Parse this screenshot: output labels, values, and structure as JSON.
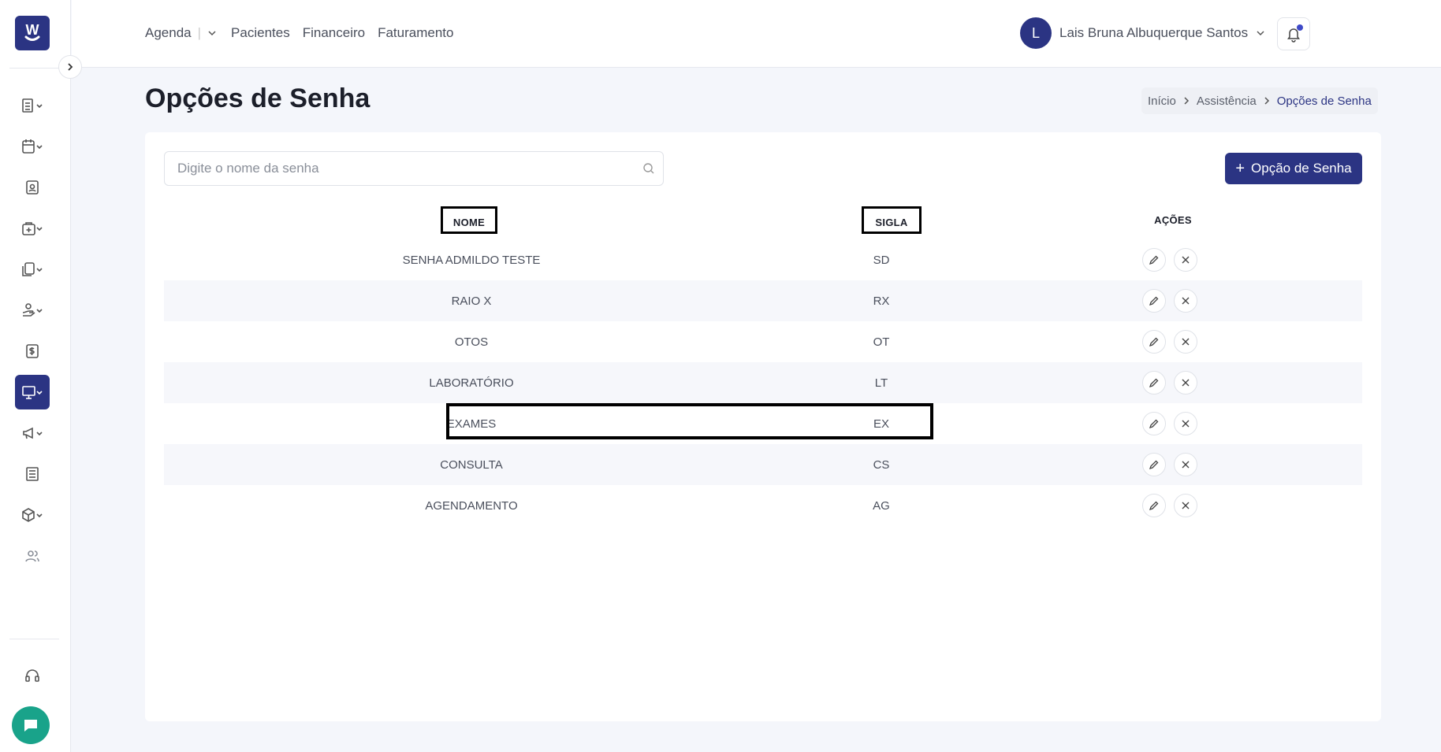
{
  "sidebar": {
    "logo_letter": "W",
    "items": [
      {
        "icon": "list-icon"
      },
      {
        "icon": "calendar-icon"
      },
      {
        "icon": "patient-card-icon"
      },
      {
        "icon": "medical-bag-icon"
      },
      {
        "icon": "documents-icon"
      },
      {
        "icon": "hand-care-icon"
      },
      {
        "icon": "dollar-icon"
      },
      {
        "icon": "monitor-icon"
      },
      {
        "icon": "megaphone-icon"
      },
      {
        "icon": "newspaper-icon"
      },
      {
        "icon": "box-icon"
      },
      {
        "icon": "users-icon"
      }
    ],
    "support_icon": "headset-icon",
    "chat_icon": "chat-icon"
  },
  "topbar": {
    "nav": [
      "Agenda",
      "Pacientes",
      "Financeiro",
      "Faturamento"
    ],
    "user_initial": "L",
    "user_name": "Lais Bruna Albuquerque Santos"
  },
  "page": {
    "title": "Opções de Senha",
    "breadcrumb": [
      "Início",
      "Assistência",
      "Opções de Senha"
    ]
  },
  "search": {
    "placeholder": "Digite o nome da senha",
    "value": ""
  },
  "add_button_label": "Opção de Senha",
  "table": {
    "headers": {
      "nome": "NOME",
      "sigla": "SIGLA",
      "acoes": "AÇÕES"
    },
    "rows": [
      {
        "nome": "SENHA ADMILDO TESTE",
        "sigla": "SD"
      },
      {
        "nome": "RAIO X",
        "sigla": "RX"
      },
      {
        "nome": "OTOS",
        "sigla": "OT"
      },
      {
        "nome": "LABORATÓRIO",
        "sigla": "LT"
      },
      {
        "nome": "EXAMES",
        "sigla": "EX"
      },
      {
        "nome": "CONSULTA",
        "sigla": "CS"
      },
      {
        "nome": "AGENDAMENTO",
        "sigla": "AG"
      }
    ]
  },
  "colors": {
    "primary": "#2b3483",
    "chat": "#19a38a"
  }
}
